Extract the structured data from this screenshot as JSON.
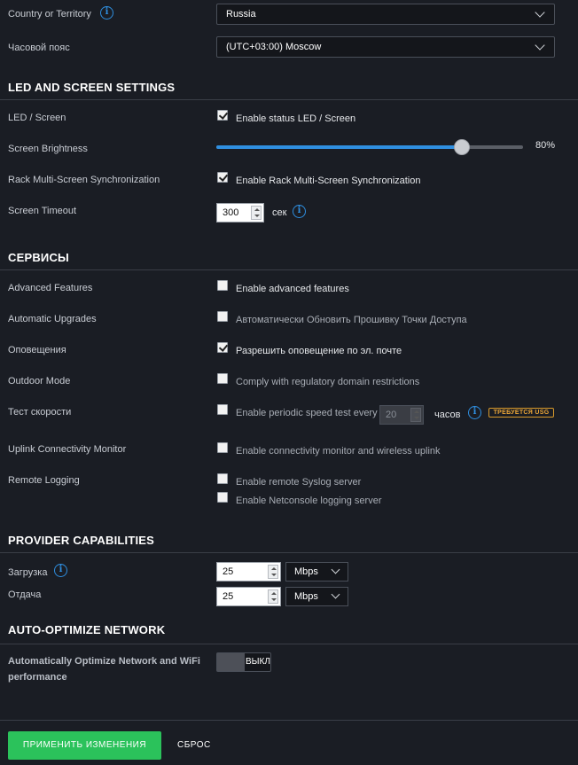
{
  "general": {
    "country_label": "Country or Territory",
    "country_value": "Russia",
    "timezone_label": "Часовой пояс",
    "timezone_value": "(UTC+03:00) Moscow"
  },
  "led": {
    "title": "LED AND SCREEN SETTINGS",
    "led_label": "LED / Screen",
    "led_checkbox": "Enable status LED / Screen",
    "led_checked": true,
    "brightness_label": "Screen Brightness",
    "brightness_value": "80%",
    "brightness_level": 0.8,
    "rack_label": "Rack Multi-Screen Synchronization",
    "rack_checkbox": "Enable Rack Multi-Screen Synchronization",
    "rack_checked": true,
    "timeout_label": "Screen Timeout",
    "timeout_value": "300",
    "timeout_unit": "сек"
  },
  "services": {
    "title": "СЕРВИСЫ",
    "advanced_label": "Advanced Features",
    "advanced_checkbox": "Enable advanced features",
    "upgrades_label": "Automatic Upgrades",
    "upgrades_checkbox": "Автоматически Обновить Прошивку Точки Доступа",
    "notify_label": "Оповещения",
    "notify_checkbox": "Разрешить оповещение по эл. почте",
    "outdoor_label": "Outdoor Mode",
    "outdoor_checkbox": "Comply with regulatory domain restrictions",
    "speed_label": "Тест скорости",
    "speed_checkbox": "Enable periodic speed test every",
    "speed_value": "20",
    "speed_unit": "часов",
    "speed_badge": "ТРЕБУЕТСЯ USG",
    "uplink_label": "Uplink Connectivity Monitor",
    "uplink_checkbox": "Enable connectivity monitor and wireless uplink",
    "logging_label": "Remote Logging",
    "syslog_checkbox": "Enable remote Syslog server",
    "netconsole_checkbox": "Enable Netconsole logging server"
  },
  "provider": {
    "title": "PROVIDER CAPABILITIES",
    "download_label": "Загрузка",
    "download_value": "25",
    "download_unit": "Mbps",
    "upload_label": "Отдача",
    "upload_value": "25",
    "upload_unit": "Mbps"
  },
  "optimize": {
    "title": "AUTO-OPTIMIZE NETWORK",
    "label_line1": "Automatically Optimize Network and WiFi",
    "label_line2": "performance",
    "toggle_text": "ВЫКЛ"
  },
  "actions": {
    "apply_label": "ПРИМЕНИТЬ ИЗМЕНЕНИЯ",
    "reset_label": "СБРОС"
  },
  "colors": {
    "accent": "#2f8fe0",
    "apply": "#2bc25b",
    "badge": "#e8a437"
  }
}
